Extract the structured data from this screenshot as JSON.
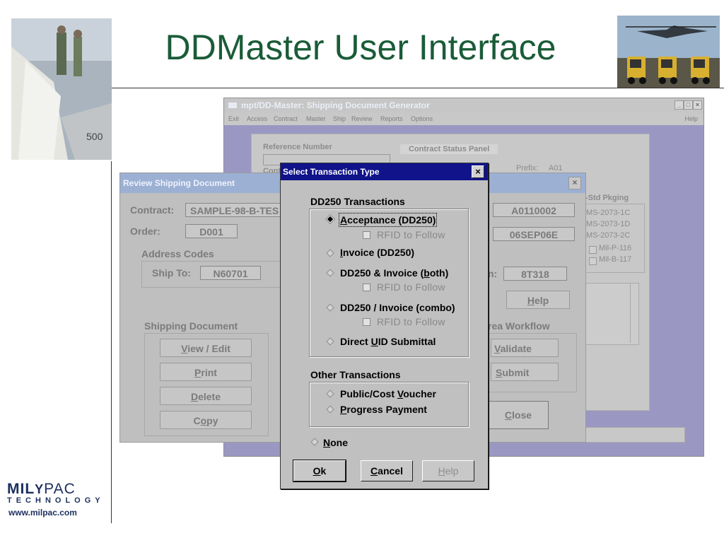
{
  "slide": {
    "title": "DDMaster User Interface",
    "logo_mil": "MIL",
    "logo_mark": "Y",
    "logo_pac": "PAC",
    "logo_sub": "TECHNOLOGY",
    "logo_url": "www.milpac.com"
  },
  "main_window": {
    "title": "mpt/DD-Master: Shipping Document Generator",
    "controls": [
      "_",
      "□",
      "×"
    ],
    "menu": [
      "Exit",
      "Access",
      "Contract",
      "Master",
      "Ship",
      "Review",
      "Reports",
      "Options"
    ],
    "help_menu": "Help",
    "reference_label": "Reference Number",
    "status_panel": "Contract Status Panel",
    "cont_label": "Cont",
    "prefix_label": "Prefix:",
    "prefix_value": "A01",
    "std_pkg_label": "-Std Pkging",
    "std_pkg_items": [
      "MS-2073-1C",
      "MS-2073-1D",
      "MS-2073-2C"
    ],
    "mil_items": [
      "Mil-P-116",
      "Mil-B-117"
    ]
  },
  "review_window": {
    "title": "Review Shipping Document",
    "contract_label": "Contract:",
    "contract_value": "SAMPLE-98-B-TES",
    "order_label": "Order:",
    "order_value": "D001",
    "address_codes": "Address Codes",
    "ship_to_label": "Ship To:",
    "ship_to_value": "N60701",
    "shipping_doc": "Shipping Document",
    "buttons": [
      "View / Edit",
      "Print",
      "Delete",
      "Copy"
    ],
    "field_a": "A0110002",
    "field_b": "06SEP06E",
    "field_c_label": "n:",
    "field_c": "8T318",
    "help_button": "Help",
    "workflow_label": "rea Workflow",
    "validate_button": "Validate",
    "submit_button": "Submit",
    "close_button": "Close"
  },
  "dialog": {
    "title": "Select Transaction Type",
    "close": "×",
    "section_dd250": "DD250 Transactions",
    "options": [
      {
        "label": "Acceptance (DD250)",
        "selected": true
      },
      {
        "label": "Invoice (DD250)",
        "selected": false
      },
      {
        "label": "DD250 & Invoice (both)",
        "selected": false
      },
      {
        "label": "DD250 / Invoice (combo)",
        "selected": false
      },
      {
        "label": "Direct UID Submittal",
        "selected": false
      }
    ],
    "rfid_label": "RFID to Follow",
    "section_other": "Other Transactions",
    "other_options": [
      "Public/Cost Voucher",
      "Progress Payment"
    ],
    "none_option": "None",
    "buttons": {
      "ok": "Ok",
      "cancel": "Cancel",
      "help": "Help"
    }
  }
}
